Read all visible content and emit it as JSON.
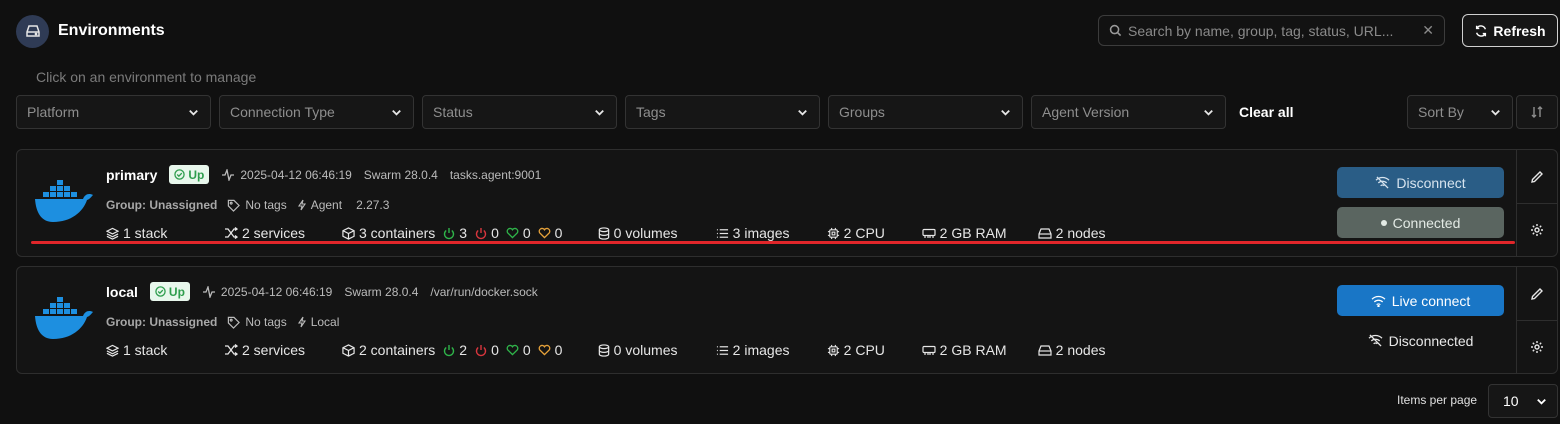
{
  "header": {
    "title": "Environments",
    "subtitle": "Click on an environment to manage",
    "search_placeholder": "Search by name, group, tag, status, URL...",
    "refresh_label": "Refresh"
  },
  "filters": {
    "items": [
      "Platform",
      "Connection Type",
      "Status",
      "Tags",
      "Groups",
      "Agent Version"
    ],
    "clear_all": "Clear all",
    "sort_by": "Sort By"
  },
  "environments": [
    {
      "name": "primary",
      "status": "Up",
      "heartbeat": "2025-04-12 06:46:19",
      "engine": "Swarm 28.0.4",
      "url": "tasks.agent:9001",
      "group": "Group: Unassigned",
      "tags": "No tags",
      "type": "Agent",
      "agent_version": "2.27.3",
      "stacks": "1 stack",
      "services": "2 services",
      "containers": "3 containers",
      "running": "3",
      "stopped": "0",
      "healthy": "0",
      "unhealthy": "0",
      "volumes": "0 volumes",
      "images": "3 images",
      "cpu": "2 CPU",
      "ram": "2 GB RAM",
      "nodes": "2 nodes",
      "primary_action": "Disconnect",
      "connection_status": "Connected"
    },
    {
      "name": "local",
      "status": "Up",
      "heartbeat": "2025-04-12 06:46:19",
      "engine": "Swarm 28.0.4",
      "url": "/var/run/docker.sock",
      "group": "Group: Unassigned",
      "tags": "No tags",
      "type": "Local",
      "stacks": "1 stack",
      "services": "2 services",
      "containers": "2 containers",
      "running": "2",
      "stopped": "0",
      "healthy": "0",
      "unhealthy": "0",
      "volumes": "0 volumes",
      "images": "2 images",
      "cpu": "2 CPU",
      "ram": "2 GB RAM",
      "nodes": "2 nodes",
      "primary_action": "Live connect",
      "connection_status": "Disconnected"
    }
  ],
  "pagination": {
    "items_per_page_label": "Items per page",
    "items_per_page": "10"
  },
  "colors": {
    "background": "#101010",
    "up_badge": "#2e9d4d",
    "running": "#2fb54a",
    "stopped": "#d9363e",
    "healthy": "#2fb54a",
    "unhealthy": "#e5a13a",
    "live_connect": "#1976c6",
    "disconnect": "#2a5d86",
    "highlight": "#e0262a"
  }
}
